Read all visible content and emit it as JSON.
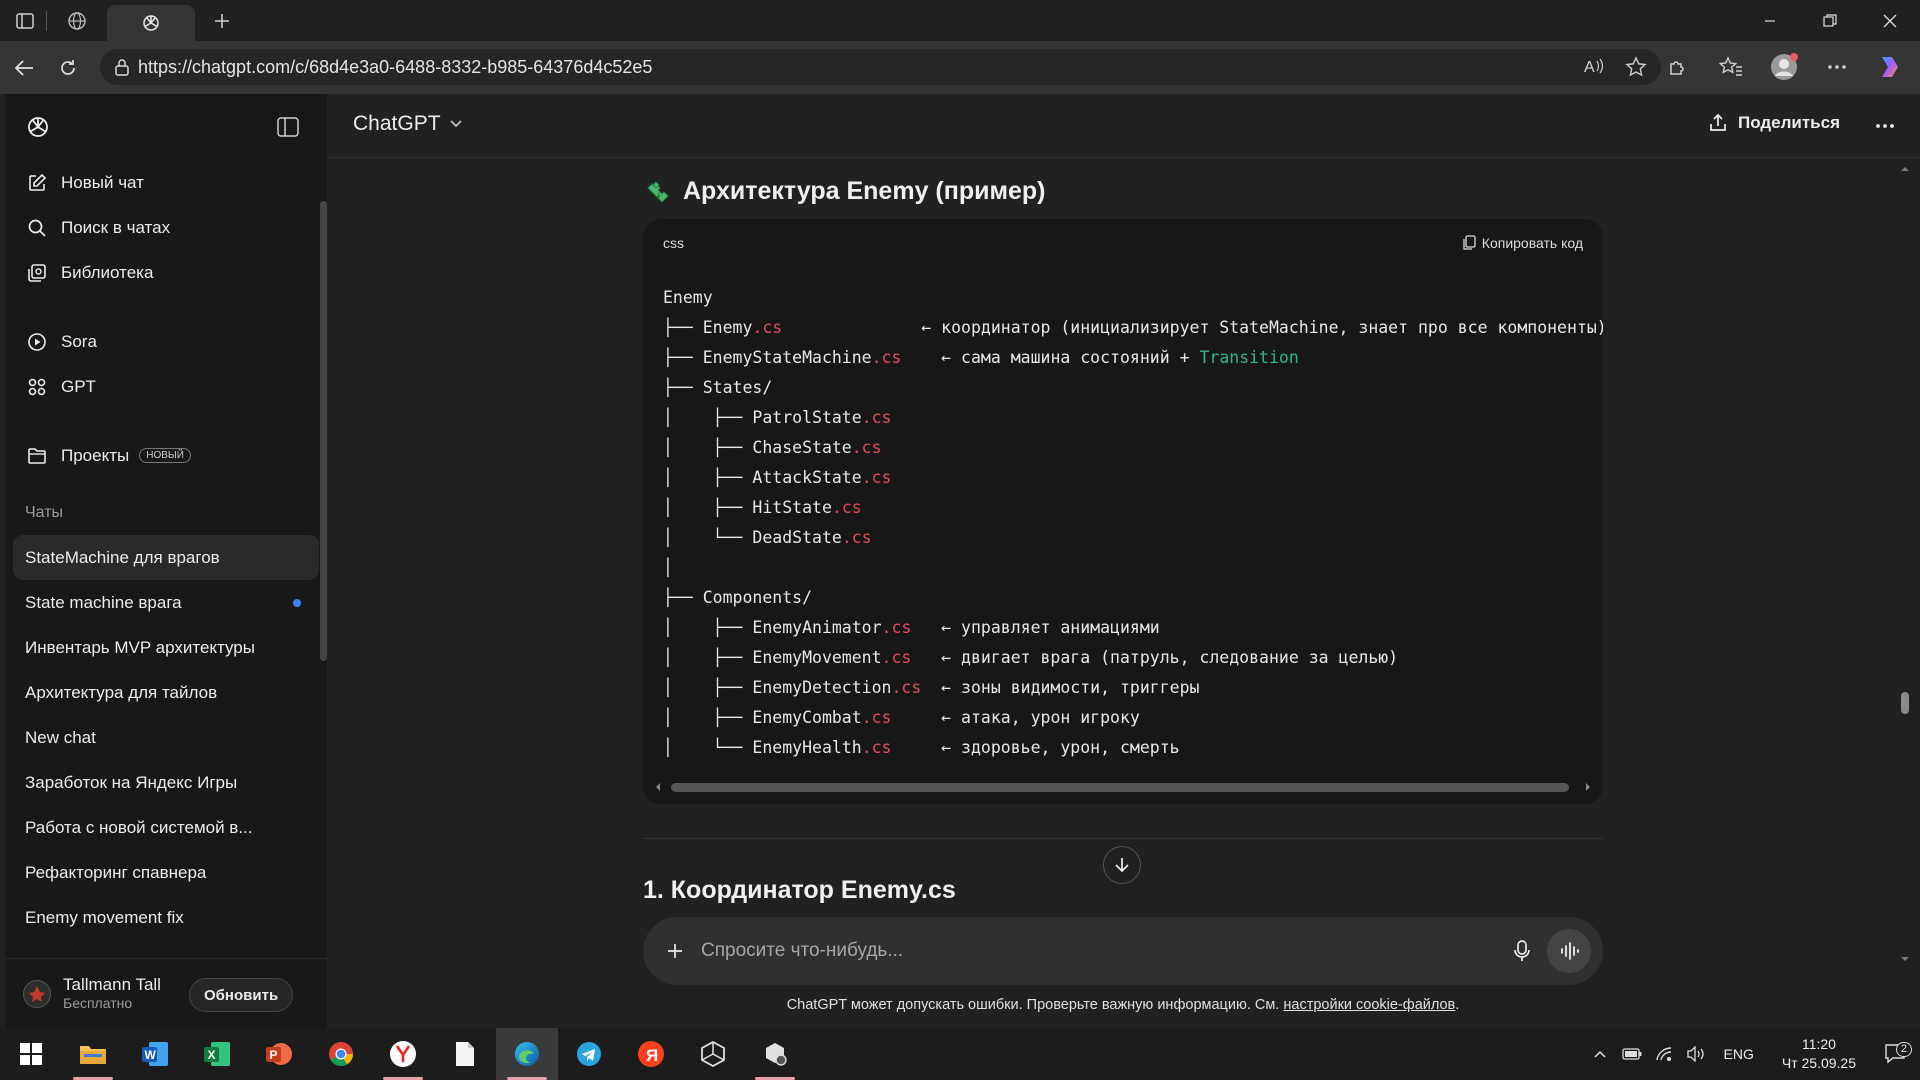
{
  "browser": {
    "url": "https://chatgpt.com/c/68d4e3a0-6488-8332-b985-64376d4c52e5",
    "icons": [
      "tab-actions-icon",
      "globe-icon",
      "chatgpt-tab-icon",
      "new-tab-icon",
      "minimize-icon",
      "restore-icon",
      "close-icon",
      "back-icon",
      "refresh-icon",
      "lock-icon",
      "read-aloud-icon",
      "favorite-icon",
      "extensions-icon",
      "favorites-icon",
      "profile-icon",
      "more-icon",
      "copilot-icon"
    ]
  },
  "sidebar": {
    "items": [
      {
        "label": "Новый чат",
        "icon": "edit-icon"
      },
      {
        "label": "Поиск в чатах",
        "icon": "search-icon"
      },
      {
        "label": "Библиотека",
        "icon": "library-icon"
      }
    ],
    "items2": [
      {
        "label": "Sora",
        "icon": "play-icon"
      },
      {
        "label": "GPT",
        "icon": "grid-icon"
      }
    ],
    "projects": {
      "label": "Проекты",
      "badge": "НОВЫЙ"
    },
    "chats_label": "Чаты",
    "chats": [
      "StateMachine для врагов",
      "State machine врага",
      "Инвентарь MVP архитектуры",
      "Архитектура для тайлов",
      "New chat",
      "Заработок на Яндекс Игры",
      "Работа с новой системой в...",
      "Рефакторинг спавнера",
      "Enemy movement fix"
    ],
    "user": {
      "name": "Tallmann Tall",
      "plan": "Бесплатно",
      "upgrade": "Обновить"
    }
  },
  "header": {
    "model": "ChatGPT",
    "share": "Поделиться"
  },
  "content": {
    "heading": "Архитектура Enemy (пример)",
    "code": {
      "lang": "css",
      "copy": "Копировать код",
      "lines": [
        [
          [
            "Enemy",
            ""
          ]
        ],
        [
          [
            "├── Enemy",
            ""
          ],
          [
            ".cs",
            "ext"
          ],
          [
            "              ← координатор (инициализирует StateMachine, знает про все компоненты)",
            ""
          ]
        ],
        [
          [
            "├── EnemyStateMachine",
            ""
          ],
          [
            ".cs",
            "ext"
          ],
          [
            "    ← сама машина состояний + ",
            ""
          ],
          [
            "Transition",
            "kw"
          ]
        ],
        [
          [
            "├── States/",
            ""
          ]
        ],
        [
          [
            "│    ├── PatrolState",
            ""
          ],
          [
            ".cs",
            "ext"
          ]
        ],
        [
          [
            "│    ├── ChaseState",
            ""
          ],
          [
            ".cs",
            "ext"
          ]
        ],
        [
          [
            "│    ├── AttackState",
            ""
          ],
          [
            ".cs",
            "ext"
          ]
        ],
        [
          [
            "│    ├── HitState",
            ""
          ],
          [
            ".cs",
            "ext"
          ]
        ],
        [
          [
            "│    └── DeadState",
            ""
          ],
          [
            ".cs",
            "ext"
          ]
        ],
        [
          [
            "│",
            ""
          ]
        ],
        [
          [
            "├── Components/",
            ""
          ]
        ],
        [
          [
            "│    ├── EnemyAnimator",
            ""
          ],
          [
            ".cs",
            "ext"
          ],
          [
            "   ← управляет анимациями",
            ""
          ]
        ],
        [
          [
            "│    ├── EnemyMovement",
            ""
          ],
          [
            ".cs",
            "ext"
          ],
          [
            "   ← двигает врага (патруль, следование за целью)",
            ""
          ]
        ],
        [
          [
            "│    ├── EnemyDetection",
            ""
          ],
          [
            ".cs",
            "ext"
          ],
          [
            "  ← зоны видимости, триггеры",
            ""
          ]
        ],
        [
          [
            "│    ├── EnemyCombat",
            ""
          ],
          [
            ".cs",
            "ext"
          ],
          [
            "     ← атака, урон игроку",
            ""
          ]
        ],
        [
          [
            "│    └── EnemyHealth",
            ""
          ],
          [
            ".cs",
            "ext"
          ],
          [
            "     ← здоровье, урон, смерть",
            ""
          ]
        ]
      ]
    },
    "next_heading": "1. Координатор Enemy.cs"
  },
  "composer": {
    "placeholder": "Спросите что-нибудь..."
  },
  "disclaimer": {
    "text": "ChatGPT может допускать ошибки. Проверьте важную информацию. См. ",
    "link": "настройки cookie-файлов",
    "end": "."
  },
  "taskbar": {
    "apps": [
      "windows-start-icon",
      "file-explorer-icon",
      "word-icon",
      "excel-icon",
      "powerpoint-icon",
      "chrome-icon",
      "yandex-browser-icon",
      "notepad-icon",
      "edge-icon",
      "telegram-icon",
      "yandex-icon",
      "unity-icon",
      "unity-hub-icon"
    ],
    "lang": "ENG",
    "time": "11:20",
    "date": "Чт 25.09.25",
    "notif_count": "2"
  },
  "colors": {
    "bg": "#212121",
    "sidebar": "#181818",
    "code_bg": "#171717",
    "ext": "#e34b5b",
    "keyword": "#2db88e",
    "accent_dot": "#3b82f6"
  }
}
